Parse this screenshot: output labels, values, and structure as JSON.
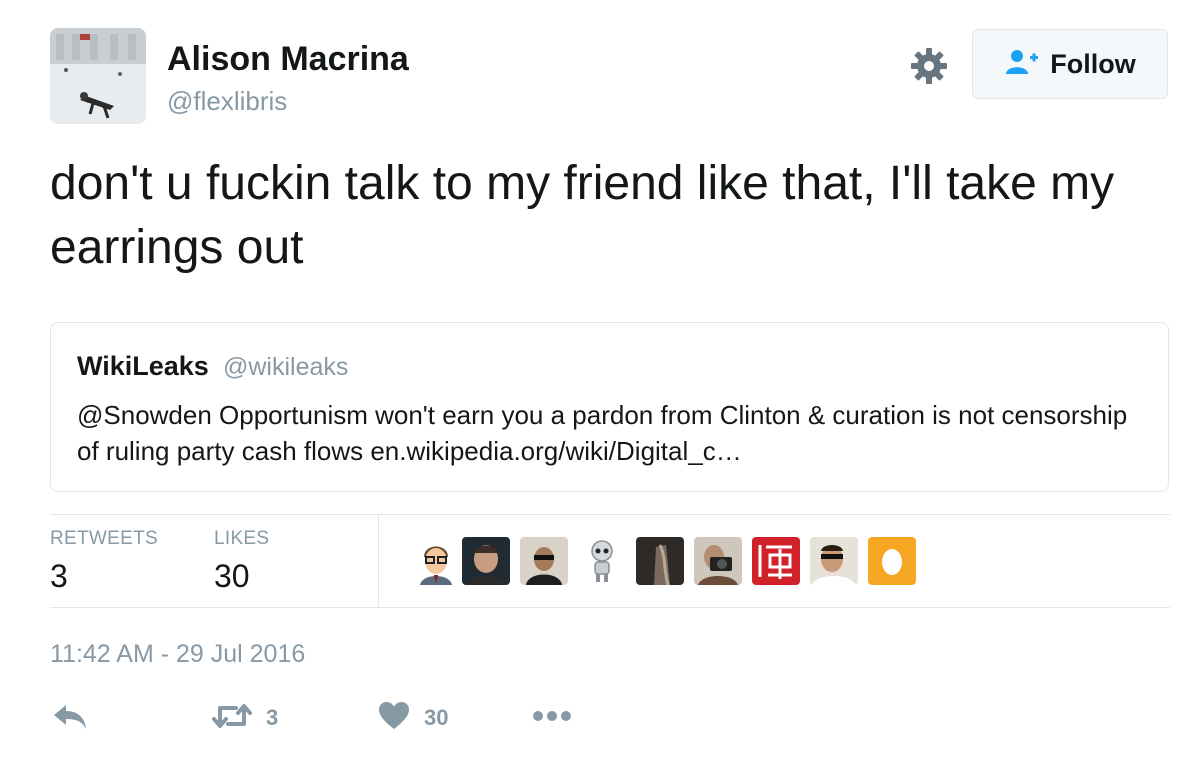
{
  "author": {
    "display_name": "Alison Macrina",
    "handle": "@flexlibris",
    "avatar": "user-avatar-photo"
  },
  "header_actions": {
    "settings_icon": "gear-icon",
    "follow_label": "Follow",
    "follow_icon": "add-user-icon"
  },
  "tweet": {
    "text": "don't u fuckin talk to my friend like that, I'll take my earrings out"
  },
  "quoted_tweet": {
    "display_name": "WikiLeaks",
    "handle": "@wikileaks",
    "text": "@Snowden Opportunism won't earn you a pardon from Clinton & curation is not censorship of ruling party cash flows en.wikipedia.org/wiki/Digital_c…"
  },
  "stats": {
    "retweets_label": "RETWEETS",
    "retweets_count": "3",
    "likes_label": "LIKES",
    "likes_count": "30"
  },
  "likers": [
    "liker-avatar-cartoon-glasses",
    "liker-avatar-man-dark",
    "liker-avatar-man-sunglasses",
    "liker-avatar-robot",
    "liker-avatar-dark-photo",
    "liker-avatar-camera",
    "liker-avatar-red-seal",
    "liker-avatar-man-selfie",
    "liker-avatar-default-egg"
  ],
  "timestamp": "11:42 AM - 29 Jul 2016",
  "actions": {
    "reply_icon": "reply-icon",
    "retweet_icon": "retweet-icon",
    "retweet_count": "3",
    "like_icon": "heart-icon",
    "like_count": "30",
    "more_icon": "more-dots-icon"
  },
  "colors": {
    "text_primary": "#14171a",
    "text_secondary": "#8899a6",
    "border": "#e1e8ed",
    "accent": "#1da1f2",
    "egg_avatar": "#f5a623"
  }
}
